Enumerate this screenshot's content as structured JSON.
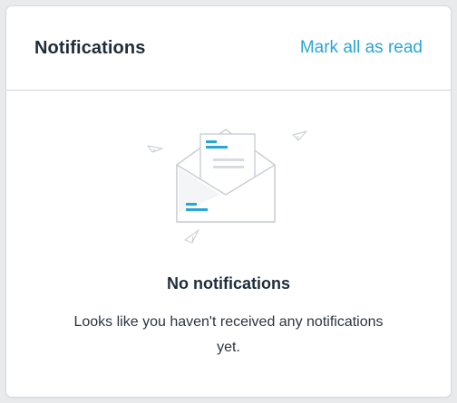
{
  "header": {
    "title": "Notifications",
    "mark_all_read": "Mark all as read"
  },
  "empty_state": {
    "illustration": "open-envelope-with-letter-icon",
    "title": "No notifications",
    "message": "Looks like you haven't received any notifications yet."
  },
  "colors": {
    "accent": "#2aa6d6",
    "text": "#1f2d3a",
    "divider": "#d3d5d8",
    "background": "#e9eaec"
  }
}
